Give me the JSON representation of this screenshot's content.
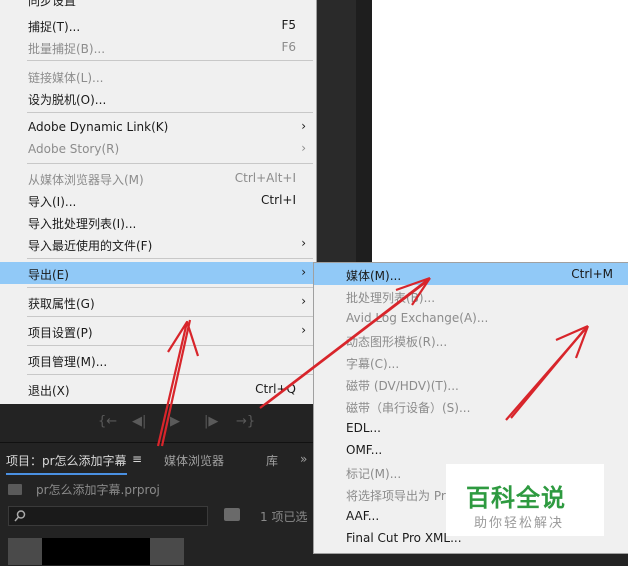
{
  "main_menu": {
    "items": [
      {
        "label": "捕捉(T)...",
        "shortcut": "F5",
        "disabled": false
      },
      {
        "label": "批量捕捉(B)...",
        "shortcut": "F6",
        "disabled": true
      },
      {
        "label": "链接媒体(L)...",
        "shortcut": "",
        "disabled": true
      },
      {
        "label": "设为脱机(O)...",
        "shortcut": "",
        "disabled": false
      },
      {
        "label": "Adobe Dynamic Link(K)",
        "shortcut": "",
        "disabled": false,
        "submenu": true
      },
      {
        "label": "Adobe Story(R)",
        "shortcut": "",
        "disabled": true,
        "submenu": true
      },
      {
        "label": "从媒体浏览器导入(M)",
        "shortcut": "Ctrl+Alt+I",
        "disabled": true
      },
      {
        "label": "导入(I)...",
        "shortcut": "Ctrl+I",
        "disabled": false
      },
      {
        "label": "导入批处理列表(I)...",
        "shortcut": "",
        "disabled": false
      },
      {
        "label": "导入最近使用的文件(F)",
        "shortcut": "",
        "disabled": false,
        "submenu": true
      },
      {
        "label": "导出(E)",
        "shortcut": "",
        "disabled": false,
        "submenu": true,
        "highlighted": true
      },
      {
        "label": "获取属性(G)",
        "shortcut": "",
        "disabled": false,
        "submenu": true
      },
      {
        "label": "项目设置(P)",
        "shortcut": "",
        "disabled": false,
        "submenu": true
      },
      {
        "label": "项目管理(M)...",
        "shortcut": "",
        "disabled": false
      },
      {
        "label": "退出(X)",
        "shortcut": "Ctrl+Q",
        "disabled": false
      }
    ],
    "submenu_arrow": "›"
  },
  "export_submenu": {
    "items": [
      {
        "label": "媒体(M)...",
        "shortcut": "Ctrl+M",
        "disabled": false,
        "highlighted": true
      },
      {
        "label": "批处理列表(B)...",
        "shortcut": "",
        "disabled": true
      },
      {
        "label": "Avid Log Exchange(A)...",
        "shortcut": "",
        "disabled": true
      },
      {
        "label": "动态图形模板(R)...",
        "shortcut": "",
        "disabled": true
      },
      {
        "label": "字幕(C)...",
        "shortcut": "",
        "disabled": true
      },
      {
        "label": "磁带 (DV/HDV)(T)...",
        "shortcut": "",
        "disabled": true
      },
      {
        "label": "磁带（串行设备）(S)...",
        "shortcut": "",
        "disabled": true
      },
      {
        "label": "EDL...",
        "shortcut": "",
        "disabled": false
      },
      {
        "label": "OMF...",
        "shortcut": "",
        "disabled": false
      },
      {
        "label": "标记(M)...",
        "shortcut": "",
        "disabled": true
      },
      {
        "label": "将选择项导出为 Pr",
        "shortcut": "",
        "disabled": true
      },
      {
        "label": "AAF...",
        "shortcut": "",
        "disabled": false
      },
      {
        "label": "Final Cut Pro XML...",
        "shortcut": "",
        "disabled": false
      }
    ]
  },
  "project_panel": {
    "tab_project": "项目：pr怎么添加字幕",
    "tab_menu_icon": "≡",
    "tab_media_browser": "媒体浏览器",
    "tab_library": "库",
    "overflow": "»",
    "project_file": "pr怎么添加字幕.prproj",
    "search_placeholder": "",
    "items_selected": "1 项已选"
  },
  "transport": {
    "buttons": [
      "{←",
      "◀|",
      "▶",
      "|▶",
      "→}"
    ]
  },
  "watermark": {
    "title": "百科全说",
    "subtitle": "助你轻松解决"
  },
  "colors": {
    "menu_bg": "#f0f0f0",
    "highlight": "#91c9f7",
    "disabled_text": "#8c8c8c",
    "arrow_red": "#d8252b",
    "watermark_green": "#2e9a40"
  }
}
